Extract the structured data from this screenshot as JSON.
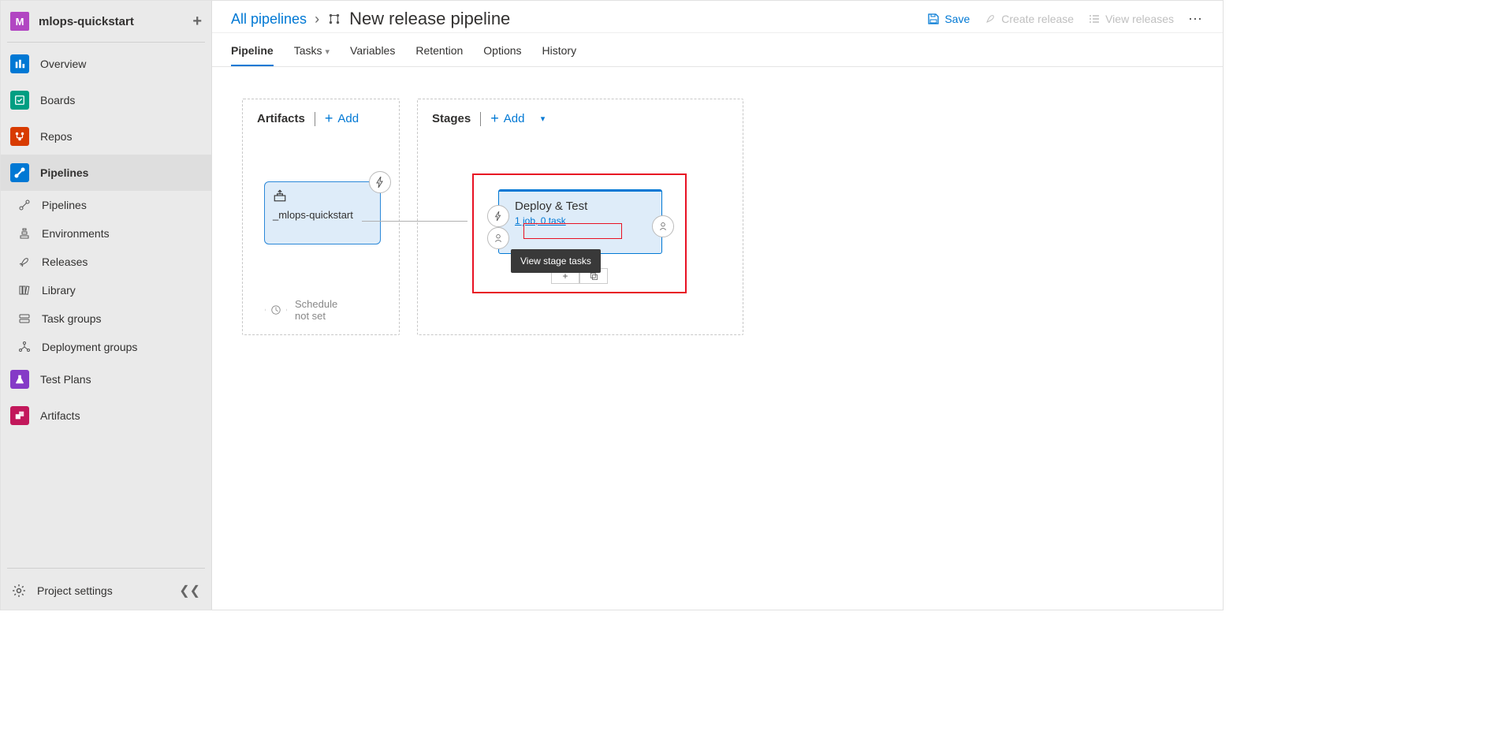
{
  "sidebar": {
    "project_initial": "M",
    "project_name": "mlops-quickstart",
    "items": [
      {
        "label": "Overview"
      },
      {
        "label": "Boards"
      },
      {
        "label": "Repos"
      },
      {
        "label": "Pipelines"
      }
    ],
    "pipeline_sub": [
      {
        "label": "Pipelines"
      },
      {
        "label": "Environments"
      },
      {
        "label": "Releases"
      },
      {
        "label": "Library"
      },
      {
        "label": "Task groups"
      },
      {
        "label": "Deployment groups"
      }
    ],
    "bottom_items": [
      {
        "label": "Test Plans"
      },
      {
        "label": "Artifacts"
      }
    ],
    "settings": "Project settings"
  },
  "breadcrumb": {
    "root": "All pipelines",
    "title": "New release pipeline"
  },
  "actions": {
    "save": "Save",
    "create": "Create release",
    "view": "View releases"
  },
  "tabs": [
    "Pipeline",
    "Tasks",
    "Variables",
    "Retention",
    "Options",
    "History"
  ],
  "artifacts": {
    "title": "Artifacts",
    "add": "Add",
    "card_name": "_mlops-quickstart",
    "schedule_l1": "Schedule",
    "schedule_l2": "not set"
  },
  "stages": {
    "title": "Stages",
    "add": "Add",
    "card_name": "Deploy & Test",
    "tasks_link": "1 job, 0 task",
    "tooltip": "View stage tasks"
  }
}
